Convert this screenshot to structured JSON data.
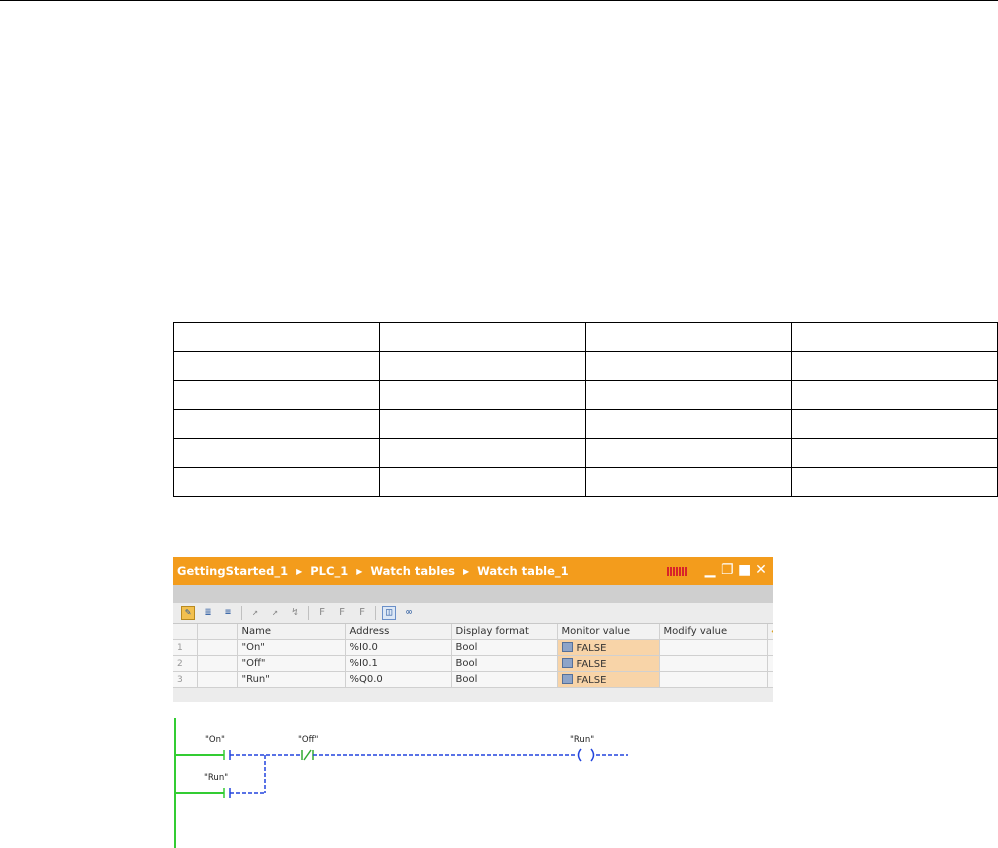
{
  "window": {
    "breadcrumb": [
      "GettingStarted_1",
      "PLC_1",
      "Watch tables",
      "Watch table_1"
    ],
    "controls": {
      "minimize": "▁",
      "restore": "❐",
      "maximize": "■",
      "close": "✕"
    }
  },
  "toolbar_icons": [
    "edit-mode-icon",
    "show-all-icon",
    "filter-icon",
    "modify-now-icon",
    "modify-trigger-icon",
    "enable-peripheral-icon",
    "force-icon",
    "force-trigger-icon",
    "force-all-icon",
    "monitor-all-icon",
    "monitor-once-icon"
  ],
  "watch_table": {
    "columns": [
      "",
      "",
      "Name",
      "Address",
      "Display format",
      "Monitor value",
      "Modify value"
    ],
    "rows": [
      {
        "index": "1",
        "name": "\"On\"",
        "address": "%I0.0",
        "format": "Bool",
        "monitor": "FALSE",
        "modify": ""
      },
      {
        "index": "2",
        "name": "\"Off\"",
        "address": "%I0.1",
        "format": "Bool",
        "monitor": "FALSE",
        "modify": ""
      },
      {
        "index": "3",
        "name": "\"Run\"",
        "address": "%Q0.0",
        "format": "Bool",
        "monitor": "FALSE",
        "modify": ""
      }
    ]
  },
  "ladder": {
    "contact_on": "\"On\"",
    "contact_off": "\"Off\"",
    "coil_run": "\"Run\"",
    "contact_run": "\"Run\"",
    "colors": {
      "rail": "#33cc33",
      "wire": "#2244dd",
      "contact_off": "#33aa33"
    }
  },
  "colors": {
    "titlebar": "#f39c1c",
    "monitor_cell": "#f8d4a8"
  }
}
